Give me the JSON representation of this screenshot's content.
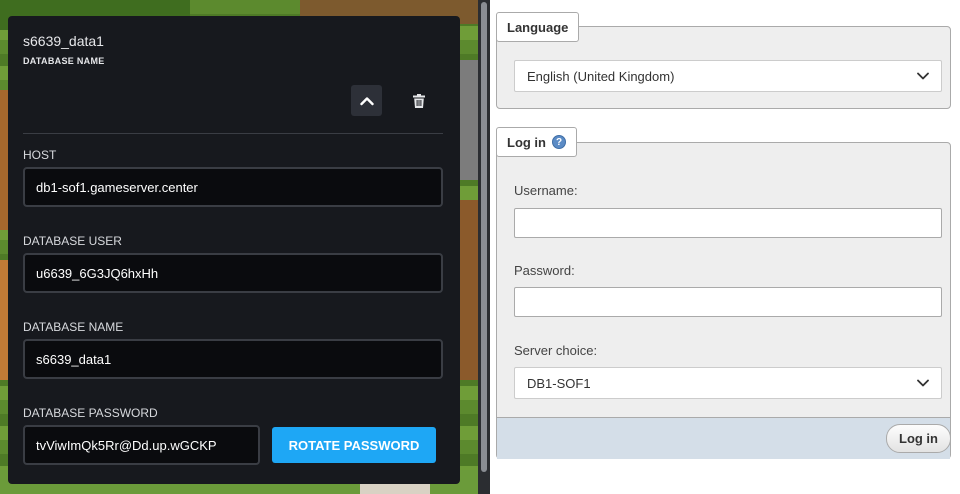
{
  "db_panel": {
    "title": "s6639_data1",
    "subtitle": "DATABASE NAME",
    "host": {
      "label": "HOST",
      "value": "db1-sof1.gameserver.center"
    },
    "db_user": {
      "label": "DATABASE USER",
      "value": "u6639_6G3JQ6hxHh"
    },
    "db_name": {
      "label": "DATABASE NAME",
      "value": "s6639_data1"
    },
    "db_password": {
      "label": "DATABASE PASSWORD",
      "value": "tvViwImQk5Rr@Dd.up.wGCKP"
    },
    "rotate_label": "ROTATE PASSWORD",
    "icons": {
      "collapse": "chevron-up-icon",
      "delete": "trash-icon"
    },
    "accent": "#1ea7f5"
  },
  "language": {
    "legend": "Language",
    "selected": "English (United Kingdom)"
  },
  "login": {
    "legend": "Log in",
    "username_label": "Username:",
    "password_label": "Password:",
    "server_label": "Server choice:",
    "server_selected": "DB1-SOF1",
    "login_button": "Log in"
  }
}
